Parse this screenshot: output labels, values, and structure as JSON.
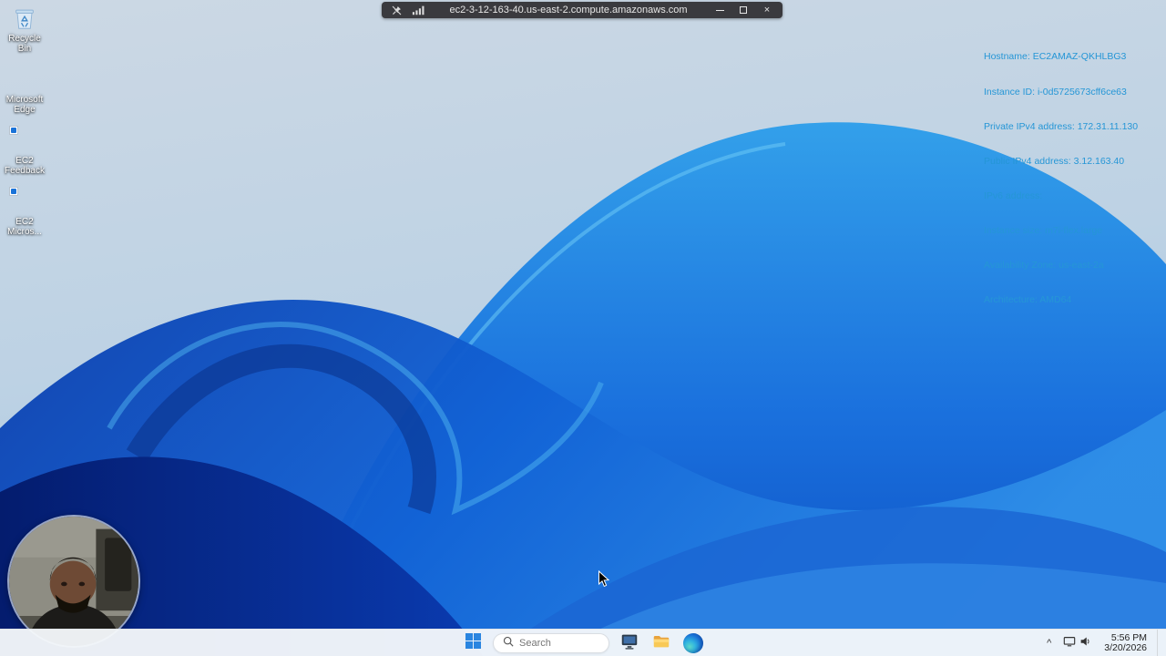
{
  "colors": {
    "info_text": "#2596d6",
    "rdp_bar_bg": "#3a3a3e",
    "taskbar_bg": "#f4f7fa",
    "bloom_bright_blue": "#1a73d8",
    "bloom_dark_navy": "#06269a"
  },
  "rdp_bar": {
    "title": "ec2-3-12-163-40.us-east-2.compute.amazonaws.com",
    "close_glyph": "×"
  },
  "desktop_icons": [
    {
      "label": "Recycle Bin"
    },
    {
      "label": "Microsoft Edge"
    },
    {
      "label": "EC2 Feedback"
    },
    {
      "label": "EC2 Micros..."
    }
  ],
  "instance_info": {
    "lines": [
      "Hostname: EC2AMAZ-QKHLBG3",
      "Instance ID: i-0d5725673cff6ce63",
      "Private IPv4 address: 172.31.11.130",
      "Public IPv4 address: 3.12.163.40",
      "IPv6 address:",
      "Instance size: m7i-flex.large",
      "Availability Zone: us-east-2a",
      "Architecture: AMD64"
    ]
  },
  "taskbar": {
    "search_placeholder": "Search"
  },
  "tray": {
    "chevron": "^",
    "time": "5:56 PM",
    "date": "3/20/2026"
  },
  "icons": {
    "rdp_pin": "pin-slash",
    "rdp_signal": "signal-bars",
    "start": "windows-logo",
    "search": "magnifier",
    "app1": "monitor-app",
    "app2": "file-explorer-folder",
    "app3": "edge-browser",
    "tray1": "monitor",
    "tray2": "speaker"
  }
}
